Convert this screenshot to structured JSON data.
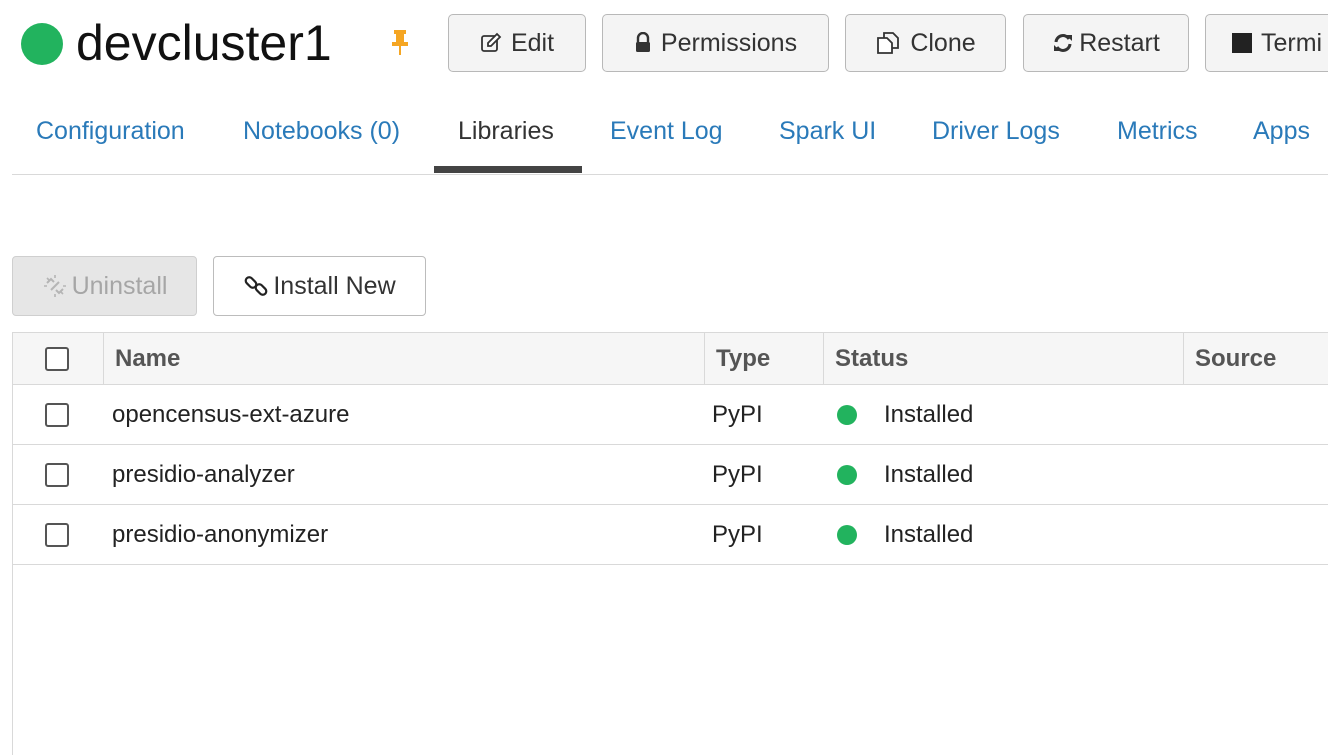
{
  "cluster": {
    "name": "devcluster1",
    "status_color": "#22b35e",
    "pin_color": "#f5a623"
  },
  "toolbar": {
    "edit_label": "Edit",
    "permissions_label": "Permissions",
    "clone_label": "Clone",
    "restart_label": "Restart",
    "terminate_label": "Termi"
  },
  "tabs": [
    {
      "label": "Configuration"
    },
    {
      "label": "Notebooks (0)"
    },
    {
      "label": "Libraries",
      "active": true
    },
    {
      "label": "Event Log"
    },
    {
      "label": "Spark UI"
    },
    {
      "label": "Driver Logs"
    },
    {
      "label": "Metrics"
    },
    {
      "label": "Apps"
    }
  ],
  "actions": {
    "uninstall_label": "Uninstall",
    "uninstall_disabled": true,
    "install_label": "Install New"
  },
  "table": {
    "columns": [
      "Name",
      "Type",
      "Status",
      "Source"
    ],
    "rows": [
      {
        "name": "opencensus-ext-azure",
        "type": "PyPI",
        "status": "Installed",
        "source": ""
      },
      {
        "name": "presidio-analyzer",
        "type": "PyPI",
        "status": "Installed",
        "source": ""
      },
      {
        "name": "presidio-anonymizer",
        "type": "PyPI",
        "status": "Installed",
        "source": ""
      }
    ]
  }
}
